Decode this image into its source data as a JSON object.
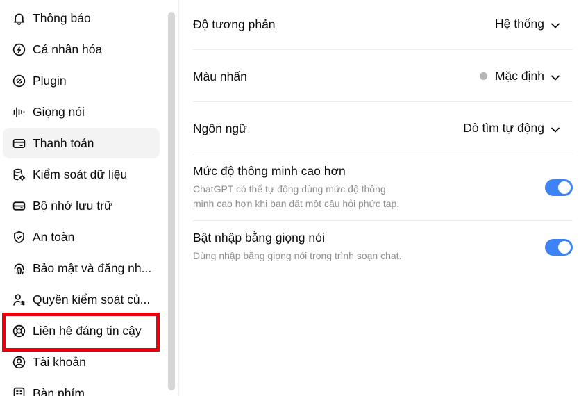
{
  "sidebar": {
    "items": [
      {
        "label": "Thông báo",
        "icon": "bell-icon"
      },
      {
        "label": "Cá nhân hóa",
        "icon": "personalization-icon"
      },
      {
        "label": "Plugin",
        "icon": "plugin-icon"
      },
      {
        "label": "Giọng nói",
        "icon": "voice-waveform-icon"
      },
      {
        "label": "Thanh toán",
        "icon": "credit-card-icon"
      },
      {
        "label": "Kiểm soát dữ liệu",
        "icon": "database-gear-icon"
      },
      {
        "label": "Bộ nhớ lưu trữ",
        "icon": "storage-drive-icon"
      },
      {
        "label": "An toàn",
        "icon": "shield-check-icon"
      },
      {
        "label": "Bảo mật và đăng nh...",
        "icon": "fingerprint-icon"
      },
      {
        "label": "Quyền kiểm soát củ...",
        "icon": "user-controls-icon"
      },
      {
        "label": "Liên hệ đáng tin cậy",
        "icon": "lifebuoy-icon"
      },
      {
        "label": "Tài khoản",
        "icon": "account-circle-icon"
      },
      {
        "label": "Bàn phím",
        "icon": "keyboard-icon"
      }
    ],
    "active_index": 4,
    "highlighted_index": 10,
    "highlight_color": "#e8000b"
  },
  "settings": {
    "contrast": {
      "label": "Độ tương phản",
      "value": "Hệ thống"
    },
    "accent": {
      "label": "Màu nhấn",
      "value": "Mặc định",
      "dot_color": "#b4b4b4"
    },
    "language": {
      "label": "Ngôn ngữ",
      "value": "Dò tìm tự động"
    },
    "smarter": {
      "label": "Mức độ thông minh cao hơn",
      "desc_line1": "ChatGPT có thể tự động dùng mức độ thông",
      "desc_line2": "minh cao hơn khi bạn đặt một câu hỏi phức tạp.",
      "enabled": true
    },
    "voice_input": {
      "label": "Bật nhập bằng giọng nói",
      "desc": "Dùng nhập bằng giọng nói trong trình soạn chat.",
      "enabled": true
    }
  },
  "colors": {
    "toggle_on": "#3d82f6",
    "active_item_bg": "#f3f3f3"
  }
}
